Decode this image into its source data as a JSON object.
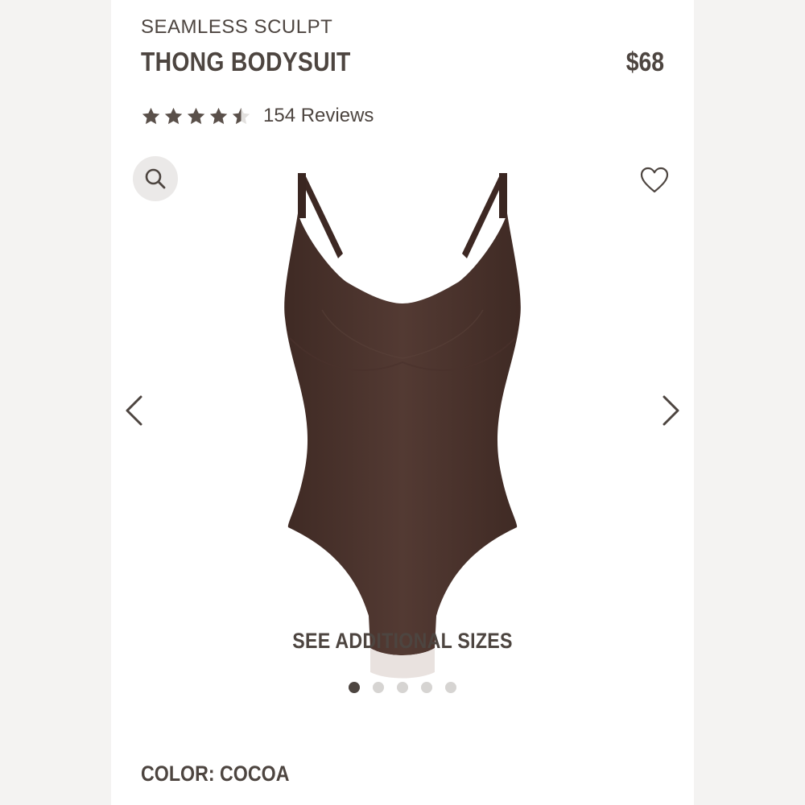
{
  "product": {
    "collection": "SEAMLESS SCULPT",
    "name": "THONG BODYSUIT",
    "price": "$68",
    "rating": 4.5,
    "reviews_text": "154 Reviews",
    "image_alt": "Cocoa seamless thong bodysuit"
  },
  "gallery": {
    "additional_sizes_label": "SEE ADDITIONAL SIZES",
    "active_index": 0,
    "count": 5
  },
  "color": {
    "label": "COLOR:",
    "value": "COCOA",
    "swatch": "#4e362f"
  },
  "icons": {
    "zoom": "magnifier-icon",
    "wishlist": "heart-icon",
    "prev": "chevron-left-icon",
    "next": "chevron-right-icon"
  },
  "theme": {
    "text": "#4d4540",
    "star": "#5a504a"
  }
}
